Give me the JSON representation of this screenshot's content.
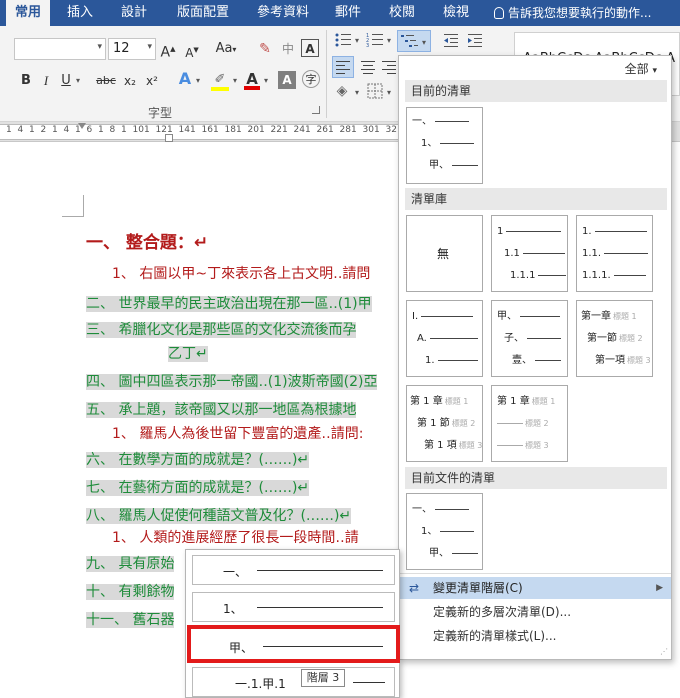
{
  "tabs": [
    "常用",
    "插入",
    "設計",
    "版面配置",
    "參考資料",
    "郵件",
    "校閱",
    "檢視"
  ],
  "tell_me": "告訴我您想要執行的動作...",
  "ribbon": {
    "font_name": "",
    "font_size": "12",
    "grow_font": "A",
    "shrink_font": "A",
    "change_case": "Aa",
    "bold": "B",
    "italic": "I",
    "underline": "U",
    "strikethrough": "abc",
    "subscript": "x₂",
    "superscript": "x²",
    "font_group_label": "字型",
    "style_preview": "AaBbCcDc AaBbCcDc A",
    "highlight_color": "#ffff00",
    "font_color": "#e00000"
  },
  "ruler": {
    "ticks": [
      "1",
      "4",
      "1",
      "2",
      "1",
      "4",
      "1",
      "6",
      "1",
      "8",
      "1",
      "10",
      "1",
      "12",
      "1",
      "14",
      "1",
      "16",
      "1",
      "18",
      "1",
      "20",
      "1",
      "22",
      "1",
      "24",
      "1",
      "26",
      "1",
      "28",
      "1",
      "30",
      "1",
      "32"
    ]
  },
  "document": {
    "lines": [
      {
        "text": "一、 整合題：↵",
        "style": "h1"
      },
      {
        "text": "1、 右圖以甲~丁來表示各上古文明‥請問",
        "style": "red"
      },
      {
        "text": "二、 世界最早的民主政治出現在那一區‥(1)甲",
        "style": "green"
      },
      {
        "text": "三、 希臘化文化是那些區的文化交流後而孕",
        "style": "green"
      },
      {
        "text": "乙丁↵",
        "style": "green"
      },
      {
        "text": "四、 圖中四區表示那一帝國‥(1)波斯帝國(2)亞",
        "style": "green"
      },
      {
        "text": "五、 承上題，該帝國又以那一地區為根據地",
        "style": "green"
      },
      {
        "text": "1、 羅馬人為後世留下豐富的遺產‥請問:",
        "style": "red"
      },
      {
        "text": "六、 在數學方面的成就是？(‥‥‥)↵",
        "style": "green"
      },
      {
        "text": "七、 在藝術方面的成就是？(‥‥‥)↵",
        "style": "green"
      },
      {
        "text": "八、 羅馬人促使何種語文普及化？(‥‥‥)↵",
        "style": "green"
      },
      {
        "text": "1、 人類的進展經歷了很長一段時間‥請",
        "style": "red"
      },
      {
        "text": "九、 具有原始",
        "style": "green"
      },
      {
        "text": "十、 有剩餘物",
        "style": "green"
      },
      {
        "text": "十一、 舊石器",
        "style": "green"
      }
    ]
  },
  "list_panel": {
    "filter_label": "全部",
    "section_current": "目前的清單",
    "section_library": "清單庫",
    "section_document": "目前文件的清單",
    "current_list": [
      "一、",
      "1、",
      "甲、"
    ],
    "none_label": "無",
    "library": [
      {
        "levels": [
          "1",
          "1.1",
          "1.1.1"
        ]
      },
      {
        "levels": [
          "1.",
          "1.1.",
          "1.1.1."
        ]
      },
      {
        "levels": [
          "I.",
          "A.",
          "1."
        ]
      },
      {
        "levels": [
          "甲、",
          "子、",
          "壹、"
        ]
      },
      {
        "levels": [
          "第一章",
          "第一節",
          "第一項"
        ],
        "tags": [
          "標題 1",
          "標題 2",
          "標題 3"
        ]
      },
      {
        "levels": [
          "第 1 章",
          "第 1 節",
          "第 1 項"
        ],
        "tags": [
          "標題 1",
          "標題 2",
          "標題 3"
        ]
      },
      {
        "levels": [
          "第 1 章",
          "",
          ""
        ],
        "tags": [
          "標題 1",
          "標題 2",
          "標題 3"
        ]
      }
    ],
    "document_list": [
      "一、",
      "1、",
      "甲、"
    ],
    "menu": {
      "change_level": "變更清單階層(C)",
      "define_multilevel": "定義新的多層次清單(D)...",
      "define_style": "定義新的清單樣式(L)..."
    }
  },
  "level_submenu": {
    "items": [
      "一、",
      "1、",
      "甲、",
      "一.1.甲.1"
    ],
    "tooltip": "階層 3"
  }
}
